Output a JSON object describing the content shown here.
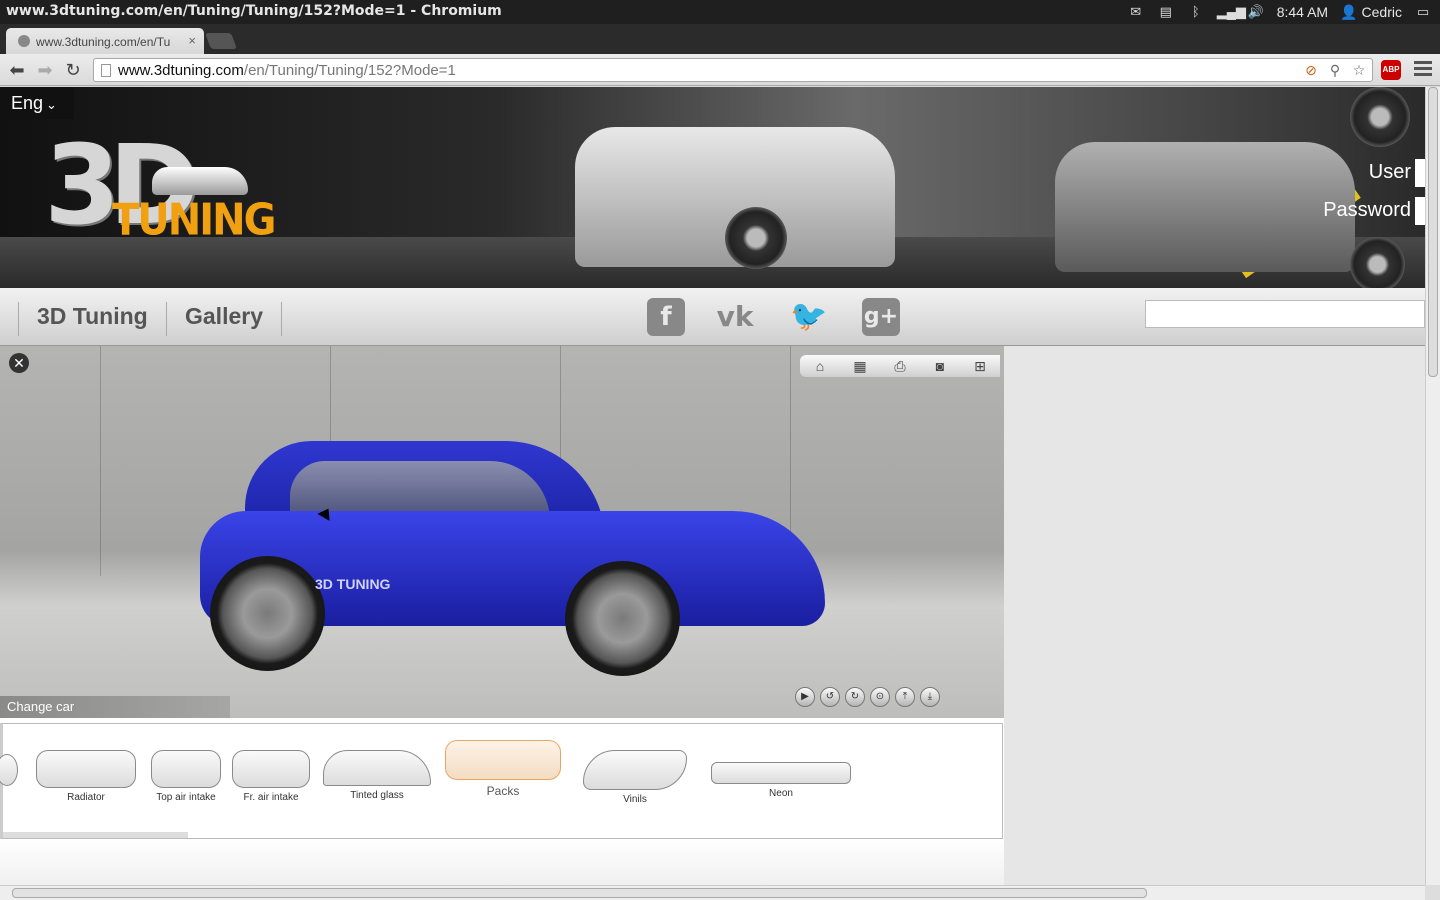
{
  "os": {
    "window_title": "www.3dtuning.com/en/Tuning/Tuning/152?Mode=1 - Chromium",
    "time": "8:44 AM",
    "user": "Cedric",
    "tray_icons": [
      "mail-icon",
      "clipboard-icon",
      "bluetooth-icon",
      "signal-icon",
      "volume-icon"
    ]
  },
  "browser": {
    "tab_title": "www.3dtuning.com/en/Tu",
    "url_host": "www.3dtuning.com",
    "url_path": "/en/Tuning/Tuning/152?Mode=1",
    "abp_label": "ABP"
  },
  "header": {
    "language": "Eng",
    "logo_3d": "3D",
    "logo_tuning": "TUNING",
    "user_label": "User",
    "password_label": "Password"
  },
  "nav": {
    "items": [
      "3D Tuning",
      "Gallery"
    ],
    "social": [
      "facebook",
      "vk",
      "twitter",
      "google-plus"
    ]
  },
  "viewer": {
    "change_car": "Change car",
    "toolbar_icons": [
      "home-icon",
      "style-icon",
      "print-icon",
      "camera-icon",
      "sitemap-icon"
    ],
    "controls": [
      "play-icon",
      "rotate-left-icon",
      "rotate-right-icon",
      "center-icon",
      "raise-icon",
      "lower-icon"
    ],
    "car_brand_text": "3D TUNING",
    "car_color": "#2a33d8"
  },
  "parts": [
    {
      "label": "Radiator"
    },
    {
      "label": "Top air intake"
    },
    {
      "label": "Fr. air intake"
    },
    {
      "label": "Tinted glass"
    },
    {
      "label": "Packs"
    },
    {
      "label": "Vinils"
    },
    {
      "label": "Neon"
    }
  ]
}
